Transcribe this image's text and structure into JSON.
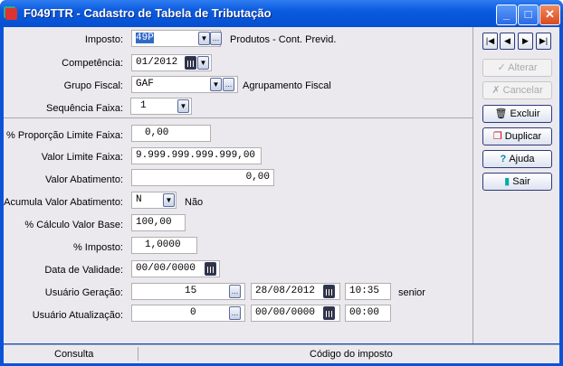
{
  "window": {
    "title": "F049TTR - Cadastro de Tabela de Tributação",
    "minimize": "_",
    "maximize": "□",
    "close": "✕"
  },
  "form": {
    "imposto": {
      "label": "Imposto:",
      "value": "49P",
      "desc": "Produtos - Cont. Previd."
    },
    "competencia": {
      "label": "Competência:",
      "value": "01/2012"
    },
    "grupo": {
      "label": "Grupo Fiscal:",
      "value": "GAF",
      "desc": "Agrupamento Fiscal"
    },
    "sequencia": {
      "label": "Sequência Faixa:",
      "value": "1"
    },
    "proporcao": {
      "label": "% Proporção Limite Faixa:",
      "value": "0,00"
    },
    "limite": {
      "label": "Valor Limite Faixa:",
      "value": "9.999.999.999.999,00"
    },
    "abatimento": {
      "label": "Valor Abatimento:",
      "value": "0,00"
    },
    "acumula": {
      "label": "Acumula Valor Abatimento:",
      "value": "N",
      "desc": "Não"
    },
    "calculo": {
      "label": "% Cálculo Valor Base:",
      "value": "100,00"
    },
    "imp": {
      "label": "% Imposto:",
      "value": "1,0000"
    },
    "validade": {
      "label": "Data de Validade:",
      "value": "00/00/0000"
    },
    "geracao": {
      "label": "Usuário Geração:",
      "user": "15",
      "date": "28/08/2012",
      "time": "10:35",
      "desc": "senior"
    },
    "atualizacao": {
      "label": "Usuário Atualização:",
      "user": "0",
      "date": "00/00/0000",
      "time": "00:00"
    }
  },
  "nav": {
    "first": "|◀",
    "prev": "◀",
    "next": "▶",
    "last": "▶|"
  },
  "buttons": {
    "alterar": "Alterar",
    "cancelar": "Cancelar",
    "excluir": "Excluir",
    "duplicar": "Duplicar",
    "ajuda": "Ajuda",
    "sair": "Sair"
  },
  "status": {
    "mode": "Consulta",
    "hint": "Código do imposto"
  }
}
